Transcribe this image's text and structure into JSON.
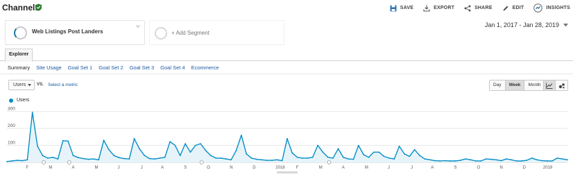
{
  "report": {
    "title": "Channels",
    "actions": [
      {
        "label": "SAVE",
        "icon": "save-icon"
      },
      {
        "label": "EXPORT",
        "icon": "export-icon"
      },
      {
        "label": "SHARE",
        "icon": "share-icon"
      },
      {
        "label": "EDIT",
        "icon": "edit-icon"
      },
      {
        "label": "INSIGHTS",
        "icon": "insights-icon"
      }
    ]
  },
  "segments": {
    "active": "Web Listings Post Landers",
    "add": "+ Add Segment"
  },
  "date_range": "Jan 1, 2017 - Jan 28, 2019",
  "tabs": {
    "explorer": "Explorer",
    "sub": [
      "Summary",
      "Site Usage",
      "Goal Set 1",
      "Goal Set 2",
      "Goal Set 3",
      "Goal Set 4",
      "Ecommerce"
    ]
  },
  "controls": {
    "metric": "Users",
    "vs": "VS.",
    "select_metric": "Select a metric",
    "granularity": [
      "Day",
      "Week",
      "Month"
    ],
    "granularity_selected": "Week"
  },
  "colors": {
    "series": "#058dc7",
    "fill": "#e6f4fa",
    "verified": "#2e7d32",
    "link": "#1a5aa0"
  },
  "chart_data": {
    "type": "area",
    "series": [
      {
        "name": "Users",
        "values": [
          5,
          8,
          12,
          10,
          15,
          295,
          95,
          40,
          25,
          30,
          20,
          128,
          125,
          40,
          28,
          22,
          18,
          20,
          15,
          130,
          75,
          40,
          28,
          22,
          20,
          140,
          80,
          40,
          22,
          20,
          25,
          30,
          122,
          100,
          40,
          110,
          60,
          100,
          110,
          70,
          40,
          25,
          25,
          20,
          15,
          70,
          160,
          50,
          25,
          18,
          15,
          12,
          12,
          15,
          10,
          140,
          55,
          30,
          25,
          25,
          30,
          100,
          60,
          30,
          25,
          80,
          30,
          20,
          18,
          100,
          45,
          30,
          60,
          60,
          35,
          25,
          20,
          95,
          50,
          35,
          75,
          40,
          20,
          15,
          10,
          8,
          10,
          8,
          8,
          12,
          20,
          15,
          8,
          8,
          20,
          18,
          15,
          10,
          20,
          15,
          8,
          8,
          12,
          25,
          15,
          10,
          8,
          8,
          25,
          20,
          15
        ]
      }
    ],
    "y_ticks": [
      100,
      200,
      300
    ],
    "ylim": [
      0,
      315
    ],
    "x_labels": [
      "F",
      "M",
      "A",
      "M",
      "J",
      "J",
      "A",
      "S",
      "O",
      "N",
      "D",
      "2018",
      "F",
      "M",
      "A",
      "M",
      "J",
      "J",
      "A",
      "S",
      "O",
      "N",
      "D",
      "2019"
    ],
    "x_label_weeks": [
      4,
      8.5,
      13,
      17.5,
      22,
      26.5,
      30.5,
      35,
      39.5,
      44,
      48.5,
      53,
      57,
      61.5,
      66,
      70.5,
      75,
      79.5,
      83.5,
      88,
      92.5,
      97,
      101.5,
      105.5
    ],
    "legend": "Users",
    "grid": true
  }
}
